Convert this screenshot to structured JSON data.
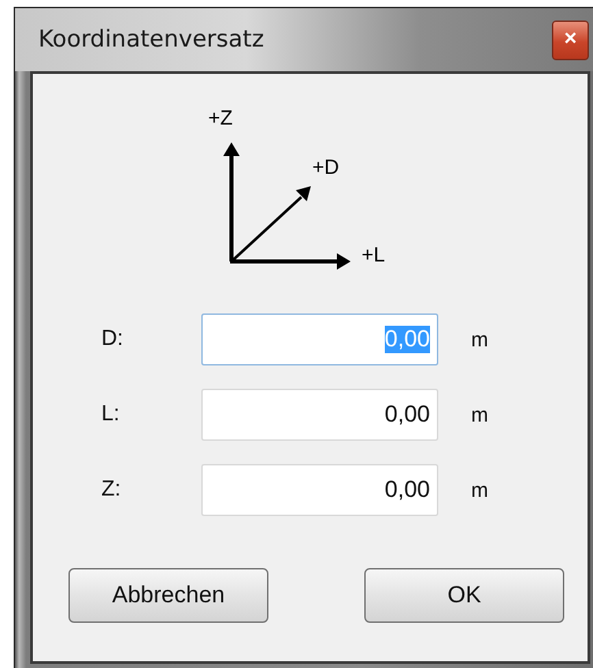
{
  "window": {
    "title": "Koordinatenversatz",
    "close_symbol": "×"
  },
  "diagram": {
    "axes": [
      {
        "kind": "up",
        "label": "+Z"
      },
      {
        "kind": "diagonal",
        "label": "+D"
      },
      {
        "kind": "right",
        "label": "+L"
      }
    ]
  },
  "fields": [
    {
      "label": "D:",
      "value": "0,00",
      "unit": "m",
      "focused": true
    },
    {
      "label": "L:",
      "value": "0,00",
      "unit": "m",
      "focused": false
    },
    {
      "label": "Z:",
      "value": "0,00",
      "unit": "m",
      "focused": false
    }
  ],
  "buttons": [
    "Abbrechen",
    "OK"
  ]
}
